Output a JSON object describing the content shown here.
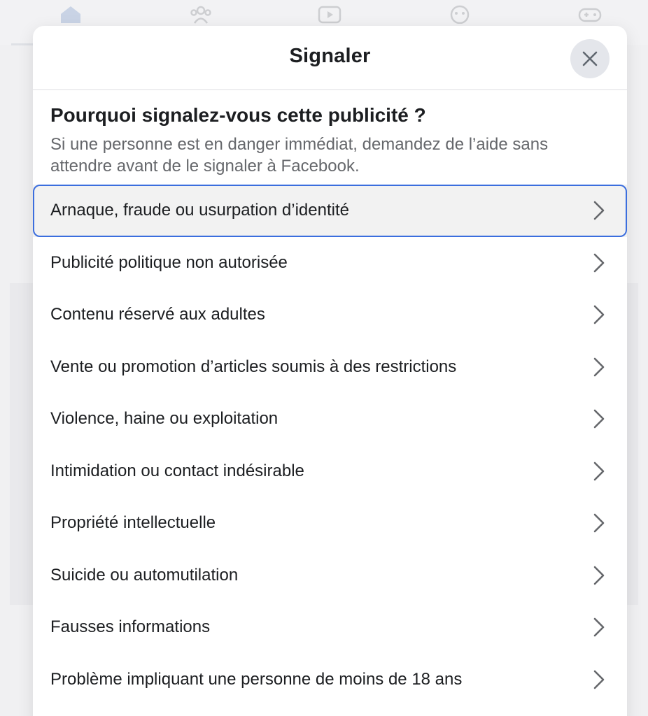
{
  "modal": {
    "title": "Signaler",
    "close_icon": "close-icon",
    "question": "Pourquoi signalez-vous cette publicité ?",
    "subtitle": "Si une personne est en danger immédiat, demandez de l’aide sans attendre avant de le signaler à Facebook."
  },
  "options": [
    {
      "label": "Arnaque, fraude ou usurpation d’identité",
      "icon": "chevron-right-icon",
      "focused": true
    },
    {
      "label": "Publicité politique non autorisée",
      "icon": "chevron-right-icon"
    },
    {
      "label": "Contenu réservé aux adultes",
      "icon": "chevron-right-icon"
    },
    {
      "label": "Vente ou promotion d’articles soumis à des restrictions",
      "icon": "chevron-right-icon"
    },
    {
      "label": "Violence, haine ou exploitation",
      "icon": "chevron-right-icon"
    },
    {
      "label": "Intimidation ou contact indésirable",
      "icon": "chevron-right-icon"
    },
    {
      "label": "Propriété intellectuelle",
      "icon": "chevron-right-icon"
    },
    {
      "label": "Suicide ou automutilation",
      "icon": "chevron-right-icon"
    },
    {
      "label": "Fausses informations",
      "icon": "chevron-right-icon"
    },
    {
      "label": "Problème impliquant une personne de moins de 18 ans",
      "icon": "chevron-right-icon"
    }
  ],
  "background_nav": {
    "icons": [
      "home-icon",
      "groups-icon",
      "video-icon",
      "marketplace-icon",
      "gaming-icon"
    ]
  },
  "colors": {
    "focus_ring": "#3b6ede",
    "title_text": "#1c1e21",
    "secondary_text": "#65676b",
    "close_bg": "#e4e6eb"
  }
}
